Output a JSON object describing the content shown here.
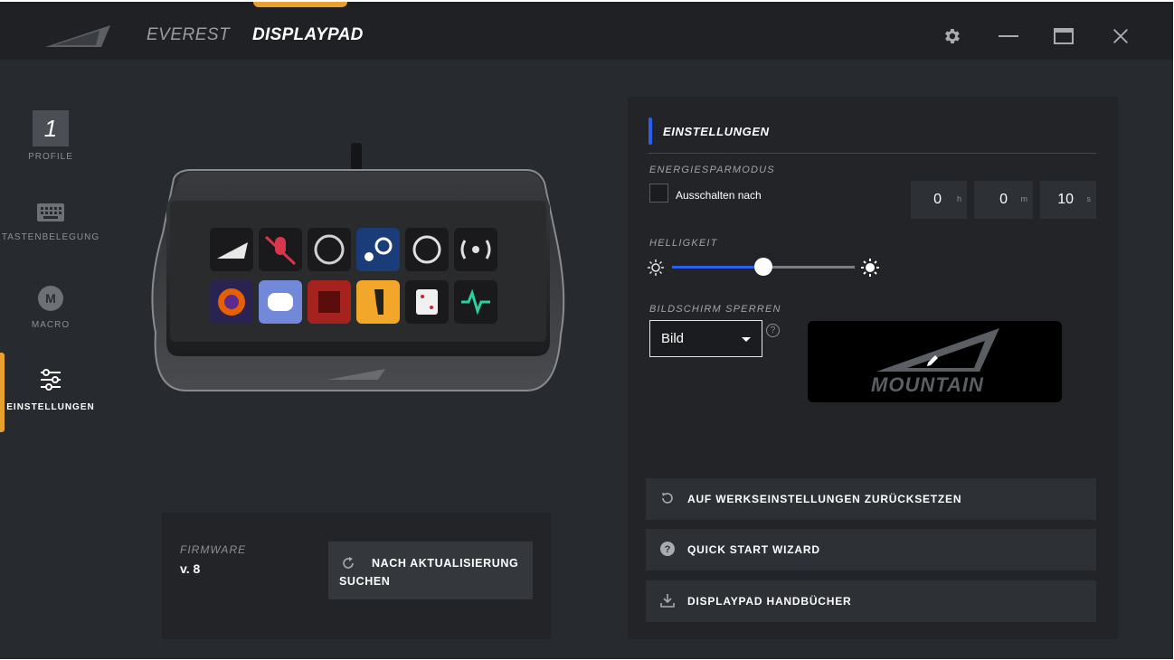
{
  "header": {
    "tabs": [
      {
        "label": "EVEREST",
        "active": false
      },
      {
        "label": "DISPLAYPAD",
        "active": true
      }
    ],
    "accent_color": "#e8a12c",
    "window_buttons": [
      "gear-icon",
      "minimize-icon",
      "maximize-icon",
      "close-icon"
    ]
  },
  "sidebar": {
    "items": [
      {
        "label": "PROFILE",
        "badge": "1",
        "icon": "profile-number"
      },
      {
        "label": "TASTENBELEGUNG",
        "icon": "keyboard-icon"
      },
      {
        "label": "MACRO",
        "badge": "M",
        "icon": "macro-icon"
      },
      {
        "label": "EINSTELLUNGEN",
        "icon": "sliders-icon",
        "active": true
      }
    ]
  },
  "device": {
    "keys_row1": [
      "mountain-logo",
      "mic-mute",
      "obs",
      "steam",
      "link-timer",
      "broadcast"
    ],
    "keys_row2": [
      "firefox",
      "discord",
      "dota",
      "counter-strike",
      "dice",
      "pulse"
    ]
  },
  "firmware": {
    "label": "FIRMWARE",
    "version": "v. 8",
    "update_button": "NACH AKTUALISIERUNG SUCHEN"
  },
  "settings": {
    "title": "EINSTELLUNGEN",
    "accent_color": "#2b5ff0",
    "energy": {
      "label": "ENERGIESPARMODUS",
      "checkbox_label": "Ausschalten nach",
      "checked": false,
      "hours": "0",
      "hours_unit": "h",
      "minutes": "0",
      "minutes_unit": "m",
      "seconds": "10",
      "seconds_unit": "s"
    },
    "brightness": {
      "label": "HELLIGKEIT",
      "value_fraction": 0.5
    },
    "lock_screen": {
      "label": "BILDSCHIRM SPERREN",
      "selected": "Bild",
      "help": "?",
      "preview_text": "MOUNTAIN"
    },
    "actions": [
      {
        "label": "AUF WERKSEINSTELLUNGEN ZURÜCKSETZEN",
        "icon": "reset-icon"
      },
      {
        "label": "QUICK START WIZARD",
        "icon": "help-icon"
      },
      {
        "label": "DISPLAYPAD HANDBÜCHER",
        "icon": "download-icon"
      }
    ]
  }
}
